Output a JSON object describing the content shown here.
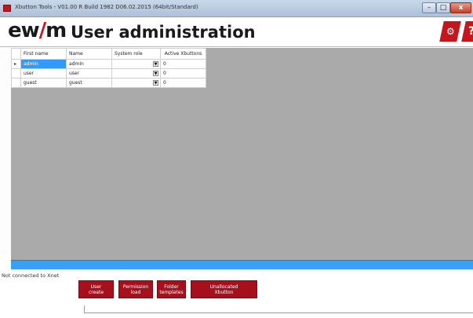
{
  "window": {
    "title": "Xbutton Tools - V01.00 R Build 1982 D06.02.2015 (64bit/Standard)",
    "minimize": "–",
    "maximize": "□",
    "close": "x"
  },
  "header": {
    "logo_prefix": "ew",
    "logo_slash": "/",
    "logo_suffix": "m",
    "title": "User administration",
    "settings_icon_glyph": "⚙",
    "help_label": "?"
  },
  "table": {
    "columns": [
      "First name",
      "Name",
      "System role",
      "Active Xbuttons"
    ],
    "rows": [
      {
        "indicator": "▸",
        "first_name": "admin",
        "name": "admin",
        "system_role": "",
        "active": "0",
        "selected": true
      },
      {
        "indicator": "",
        "first_name": "user",
        "name": "user",
        "system_role": "",
        "active": "0",
        "selected": false
      },
      {
        "indicator": "",
        "first_name": "guest",
        "name": "guest",
        "system_role": "",
        "active": "0",
        "selected": false
      }
    ]
  },
  "status": {
    "text": "Not connected to Xnet"
  },
  "buttons": {
    "user_create": "User\ncreate",
    "permission_load": "Permission\nload",
    "folder_templates": "Folder\ntemplates",
    "unallocated_xbutton": "Unallocated\nXbutton"
  },
  "colors": {
    "brand_red": "#c4161c",
    "button_red": "#a6101c",
    "selection_blue": "#3399ff",
    "status_bar_blue": "#3aa0f0",
    "workspace_grey": "#aaaaaa"
  }
}
